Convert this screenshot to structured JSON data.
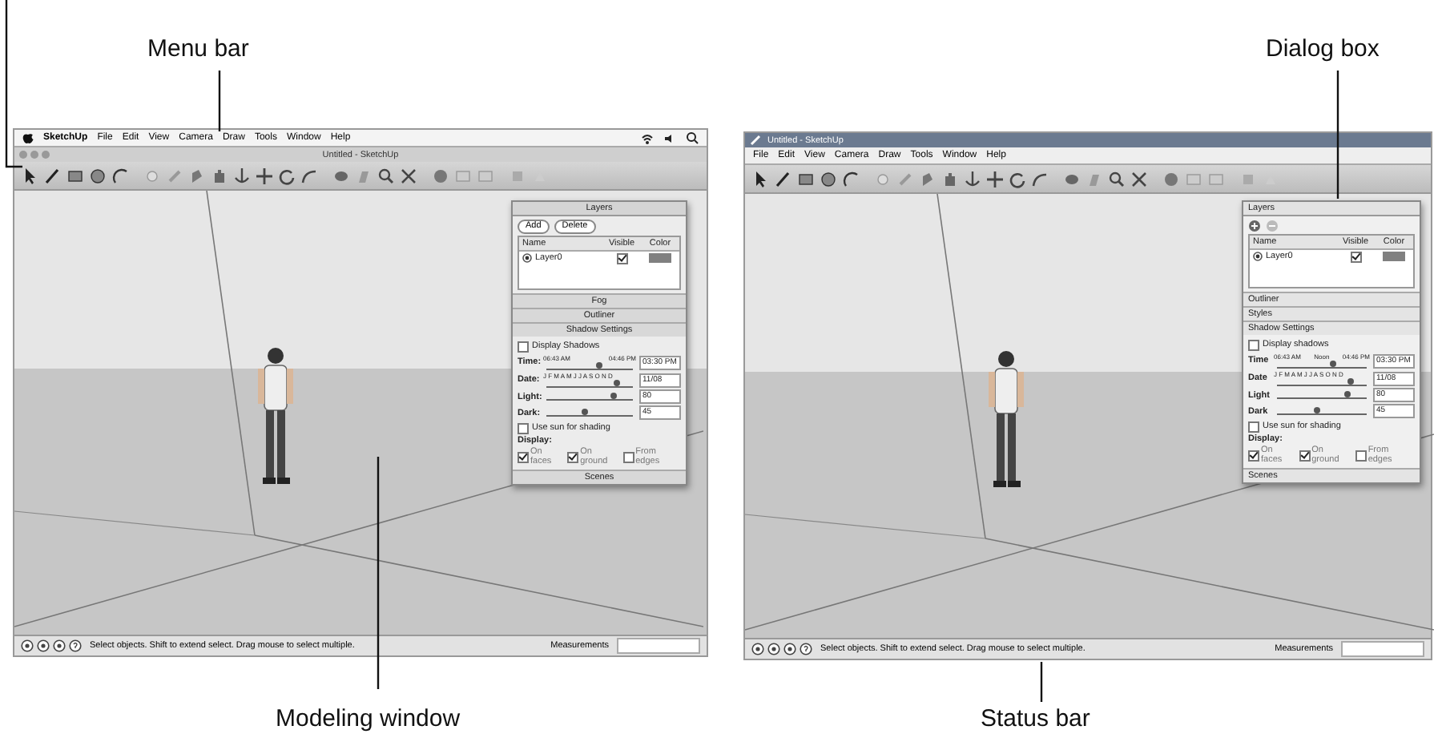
{
  "callouts": [
    {
      "kind": "menu",
      "text": "Menu bar"
    },
    {
      "kind": "dialog",
      "text": "Dialog box"
    },
    {
      "kind": "model",
      "text": "Modeling window"
    },
    {
      "kind": "status",
      "text": "Status bar"
    }
  ],
  "screens": [
    {
      "kind": "mac",
      "menu": [
        "SketchUp",
        "File",
        "Edit",
        "View",
        "Camera",
        "Draw",
        "Tools",
        "Window",
        "Help"
      ],
      "title": "Untitled - SketchUp",
      "dialog": {
        "title": "Layers",
        "buttons": [
          "Add",
          "Delete"
        ],
        "columns": [
          "Name",
          "Visible",
          "Color"
        ],
        "layers": [
          {
            "name": "Layer0",
            "visible": true
          }
        ],
        "sections": [
          "Fog",
          "Outliner",
          "Shadow Settings"
        ],
        "display_shadows": {
          "label": "Display Shadows",
          "checked": false
        },
        "time": {
          "label": "Time:",
          "start": "06:43 AM",
          "end": "04:46 PM",
          "level": 0.62,
          "value": "03:30 PM"
        },
        "date": {
          "label": "Date:",
          "months": "J F M A M J J A S O N D",
          "level": 0.82,
          "value": "11/08"
        },
        "light": {
          "label": "Light:",
          "level": 0.78,
          "value": "80"
        },
        "dark": {
          "label": "Dark:",
          "level": 0.45,
          "value": "45"
        },
        "use_sun": {
          "label": "Use sun for shading",
          "checked": false
        },
        "display_label": "Display:",
        "options": [
          {
            "label": "On faces",
            "checked": true
          },
          {
            "label": "On ground",
            "checked": true
          },
          {
            "label": "From edges",
            "checked": false
          }
        ],
        "footer": "Scenes"
      },
      "status": "Select objects. Shift to extend select. Drag mouse to select multiple.",
      "measurements": "Measurements"
    },
    {
      "kind": "windows",
      "menu": [
        "File",
        "Edit",
        "View",
        "Camera",
        "Draw",
        "Tools",
        "Window",
        "Help"
      ],
      "title": "Untitled - SketchUp",
      "dialog": {
        "title": "Layers",
        "columns": [
          "Name",
          "Visible",
          "Color"
        ],
        "layers": [
          {
            "name": "Layer0",
            "visible": true
          }
        ],
        "sections": [
          "Outliner",
          "Styles",
          "Shadow Settings"
        ],
        "display_shadows": {
          "label": "Display shadows",
          "checked": false
        },
        "time": {
          "label": "Time",
          "start": "06:43 AM",
          "middle": "Noon",
          "end": "04:46 PM",
          "level": 0.62,
          "value": "03:30 PM"
        },
        "date": {
          "label": "Date",
          "months": "J F M A M J J A S O N D",
          "level": 0.82,
          "value": "11/08"
        },
        "light": {
          "label": "Light",
          "level": 0.78,
          "value": "80"
        },
        "dark": {
          "label": "Dark",
          "level": 0.45,
          "value": "45"
        },
        "use_sun": {
          "label": "Use sun for shading",
          "checked": false
        },
        "display_label": "Display:",
        "options": [
          {
            "label": "On faces",
            "checked": true
          },
          {
            "label": "On ground",
            "checked": true
          },
          {
            "label": "From edges",
            "checked": false
          }
        ],
        "footer": "Scenes"
      },
      "status": "Select objects. Shift to extend select. Drag mouse to select multiple.",
      "measurements": "Measurements"
    }
  ]
}
